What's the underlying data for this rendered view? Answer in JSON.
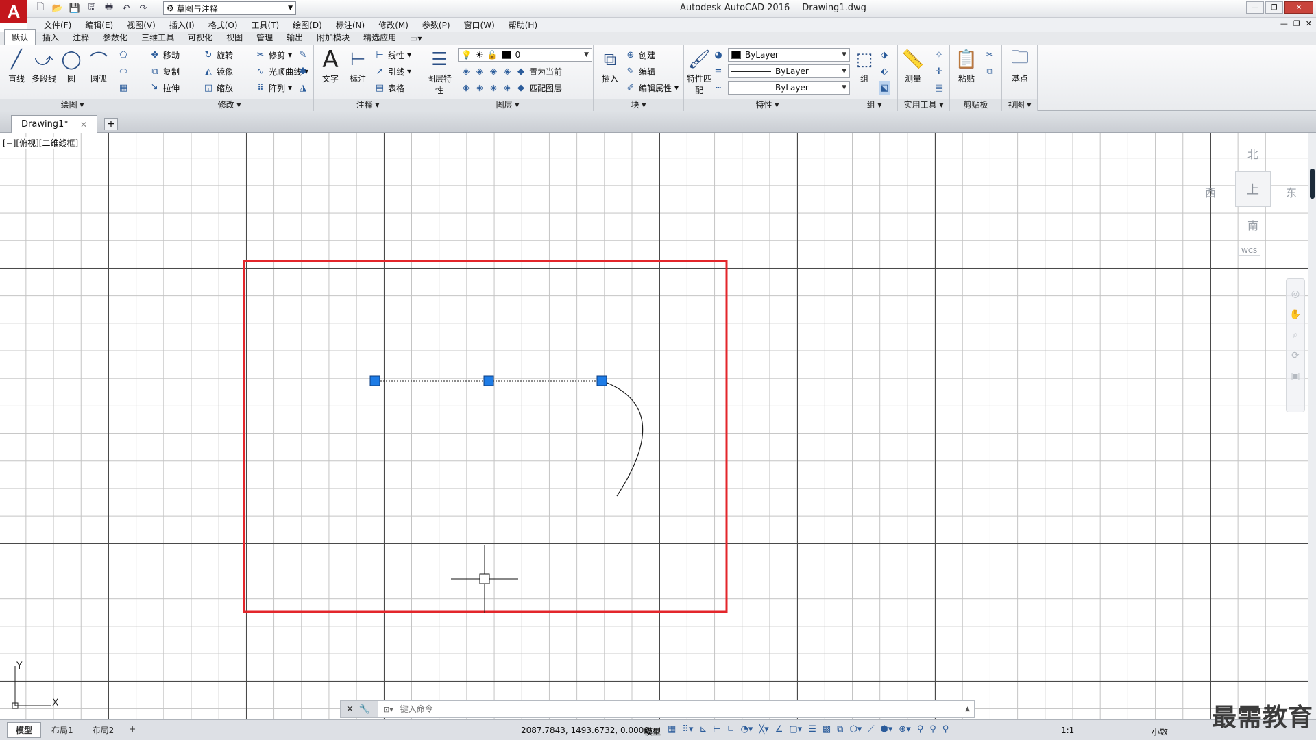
{
  "app": {
    "logo_letter": "A",
    "title": "Autodesk AutoCAD 2016",
    "document": "Drawing1.dwg",
    "workspace": "草图与注释"
  },
  "menu": [
    "文件(F)",
    "编辑(E)",
    "视图(V)",
    "插入(I)",
    "格式(O)",
    "工具(T)",
    "绘图(D)",
    "标注(N)",
    "修改(M)",
    "参数(P)",
    "窗口(W)",
    "帮助(H)"
  ],
  "ribbon_tabs": [
    "默认",
    "插入",
    "注释",
    "参数化",
    "三维工具",
    "可视化",
    "视图",
    "管理",
    "输出",
    "附加模块",
    "精选应用"
  ],
  "panels": {
    "draw": {
      "title": "绘图",
      "line": "直线",
      "polyline": "多段线",
      "circle": "圆",
      "arc": "圆弧"
    },
    "modify": {
      "title": "修改",
      "move": "移动",
      "rotate": "旋转",
      "trim": "修剪",
      "copy": "复制",
      "mirror": "镜像",
      "fillet": "光顺曲线",
      "stretch": "拉伸",
      "scale": "缩放",
      "array": "阵列"
    },
    "annotation": {
      "title": "注释",
      "text": "文字",
      "dimension": "标注",
      "linear": "线性",
      "leader": "引线",
      "table": "表格"
    },
    "layers": {
      "title": "图层",
      "properties": "图层特性",
      "current_layer": "0",
      "make_current": "置为当前",
      "match_layer": "匹配图层"
    },
    "block": {
      "title": "块",
      "insert": "插入",
      "create": "创建",
      "edit": "编辑",
      "edit_attributes": "编辑属性"
    },
    "properties": {
      "title": "特性",
      "match": "特性匹配",
      "color": "ByLayer",
      "linetype": "ByLayer",
      "lineweight": "ByLayer"
    },
    "groups": {
      "title": "组",
      "group": "组"
    },
    "utilities": {
      "title": "实用工具",
      "measure": "测量"
    },
    "clipboard": {
      "title": "剪贴板",
      "paste": "粘贴"
    },
    "view": {
      "title": "视图",
      "base": "基点"
    }
  },
  "doc_tab": {
    "label": "Drawing1*"
  },
  "viewport_label": "[−][俯视][二维线框]",
  "viewcube": {
    "north": "北",
    "south": "南",
    "east": "东",
    "west": "西",
    "face": "上",
    "wcs": "WCS"
  },
  "ucs": {
    "x": "X",
    "y": "Y"
  },
  "command": {
    "placeholder": "键入命令"
  },
  "status": {
    "layouts": [
      "模型",
      "布局1",
      "布局2"
    ],
    "coords": "2087.7843, 1493.6732, 0.0000",
    "model": "模型",
    "scale": "1:1",
    "units": "小数"
  },
  "watermark": "最需教育",
  "colors": {
    "selection_rect": "#e3262b",
    "grip": "#1e7ce6",
    "logo": "#c3171c"
  }
}
